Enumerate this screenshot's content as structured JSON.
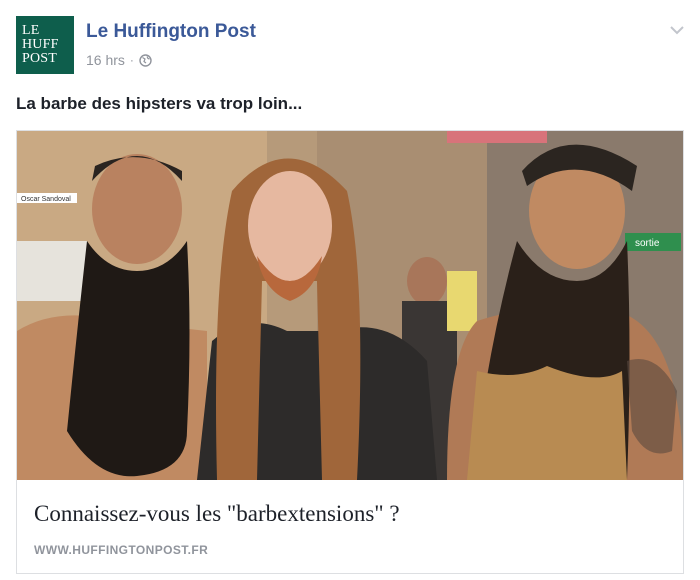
{
  "post": {
    "page_logo_lines": [
      "LE",
      "HUFF",
      "POST"
    ],
    "page_name": "Le Huffington Post",
    "timestamp": "16 hrs",
    "separator": "·",
    "privacy_icon": "globe-icon",
    "menu_icon": "chevron-down-icon",
    "status_text": "La barbe des hipsters va trop loin..."
  },
  "link": {
    "title": "Connaissez-vous les \"barbextensions\" ?",
    "domain": "WWW.HUFFINGTONPOST.FR",
    "image_sign_left": "Oscar Sandoval",
    "image_sign_right": "sortie"
  },
  "colors": {
    "brand_green": "#0e5e4c",
    "link_blue": "#3b5998",
    "meta_gray": "#90949c"
  }
}
